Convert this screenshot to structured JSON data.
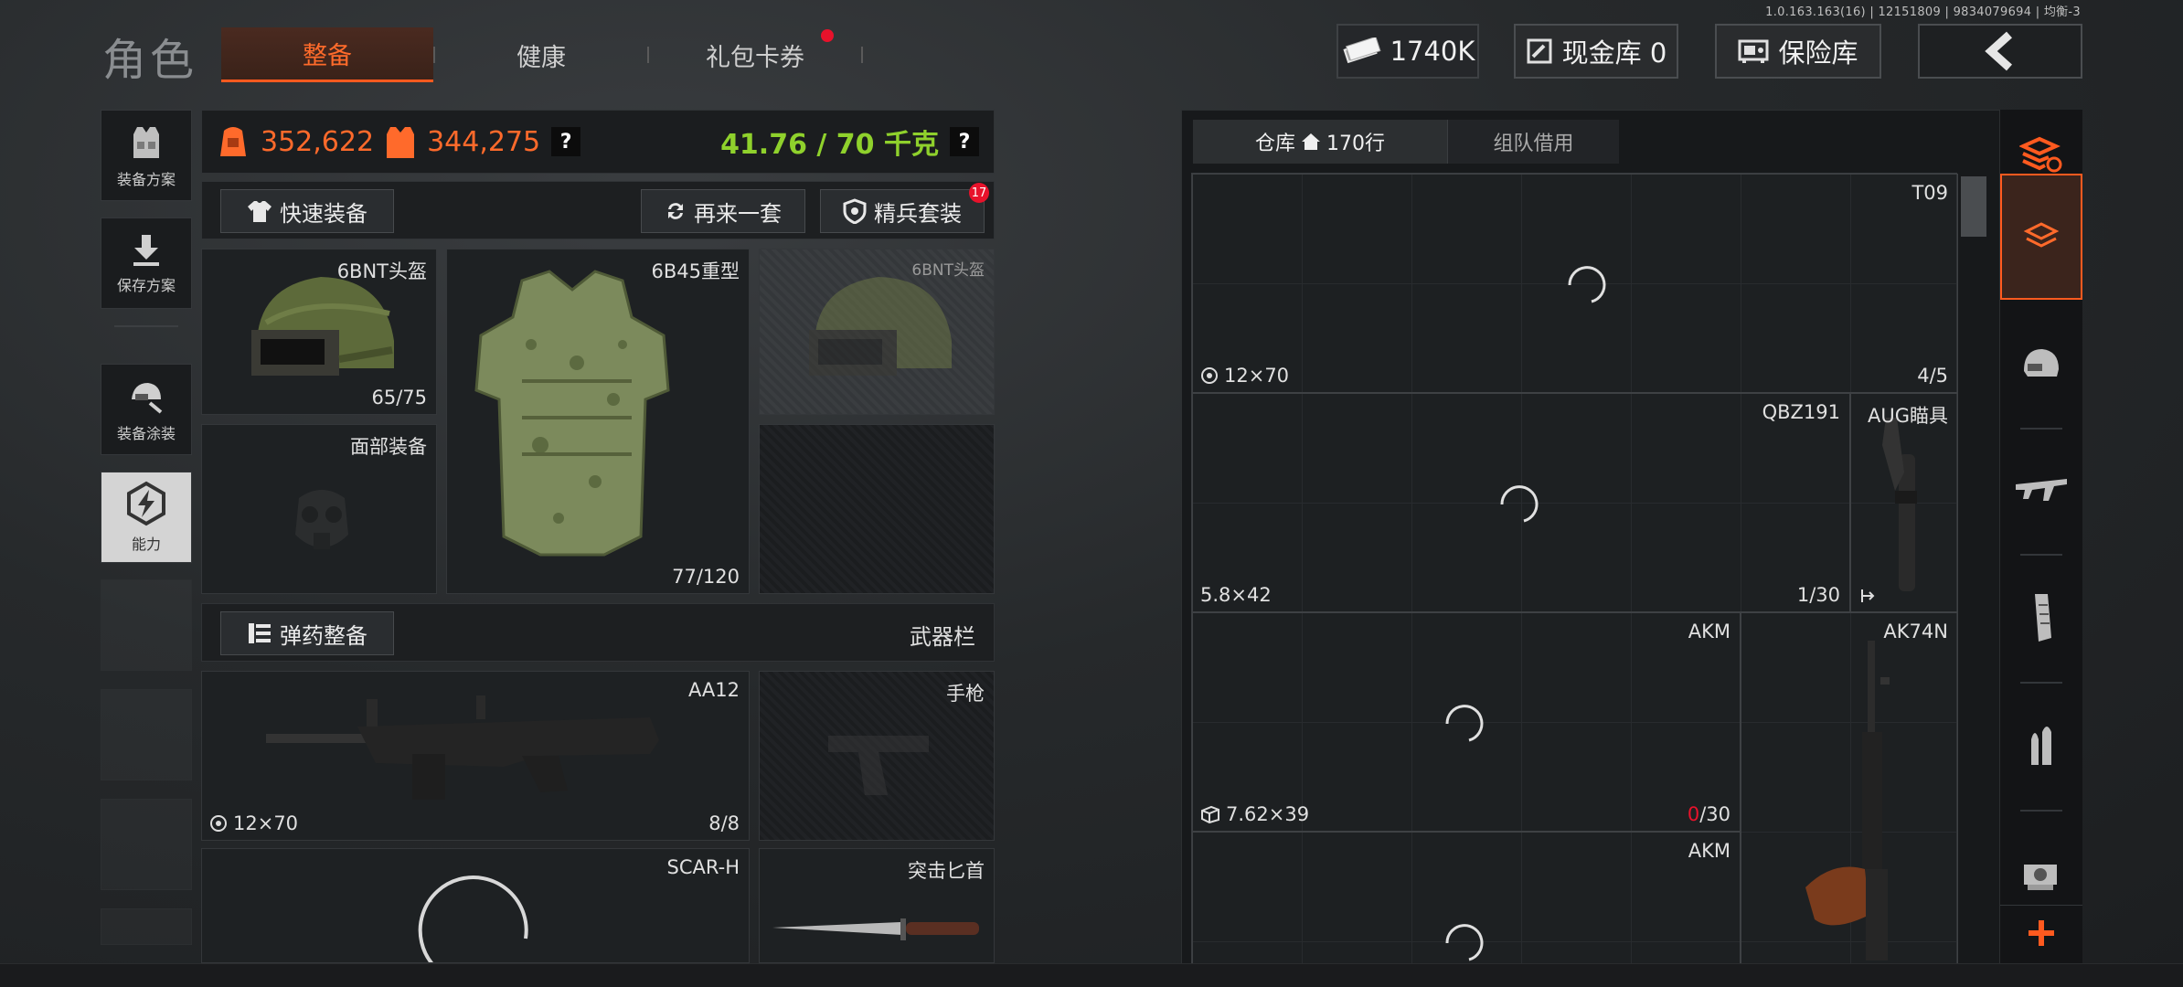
{
  "build_info": "1.0.163.163(16) | 12151809 | 9834079694 | 均衡-3",
  "header": {
    "title": "角色",
    "tabs": [
      {
        "label": "整备",
        "active": true
      },
      {
        "label": "健康",
        "active": false
      },
      {
        "label": "礼包卡券",
        "active": false,
        "has_notification": true
      }
    ],
    "money": "1740K",
    "cash_vault": "现金库 0",
    "safe": "保险库",
    "back_icon": "chevron-left-icon"
  },
  "sidebar": {
    "items": [
      {
        "label": "装备方案",
        "icon": "vest-icon"
      },
      {
        "label": "保存方案",
        "icon": "download-icon"
      },
      {
        "label": "装备涂装",
        "icon": "paint-helmet-icon"
      },
      {
        "label": "能力",
        "icon": "lightning-hex-icon",
        "selected": true
      }
    ]
  },
  "stats": {
    "value_1": "352,622",
    "value_2": "344,275",
    "help": "?",
    "weight": "41.76 / 70 千克"
  },
  "actions": {
    "quick_equip": "快速装备",
    "reroll": "再来一套",
    "elite_set": "精兵套装",
    "elite_badge": "17"
  },
  "equipment": {
    "helmet": {
      "title": "6BNT头盔",
      "count": "65/75"
    },
    "armor": {
      "title": "6B45重型",
      "count": "77/120"
    },
    "helmet_ghost": {
      "title": "6BNT头盔"
    },
    "face": {
      "title": "面部装备"
    }
  },
  "ammo_bar": {
    "ammo_equip": "弹药整备",
    "weapon_bar": "武器栏"
  },
  "weapons": {
    "primary": {
      "title": "AA12",
      "ammo": "12×70",
      "count": "8/8"
    },
    "pistol": {
      "title": "手枪"
    },
    "secondary": {
      "title": "SCAR-H"
    },
    "melee": {
      "title": "突击匕首"
    }
  },
  "warehouse": {
    "tab_storage": "仓库",
    "rows": "170行",
    "tab_team": "组队借用",
    "items": [
      {
        "title": "T09",
        "ammo": "12×70",
        "count": "4/5"
      },
      {
        "title": "QBZ191",
        "ammo": "5.8×42",
        "count": "1/30"
      },
      {
        "title": "AUG瞄具"
      },
      {
        "title": "AKM",
        "ammo": "7.62×39",
        "count_red": "0",
        "count_rest": "/30"
      },
      {
        "title": "AK74N"
      },
      {
        "title": "AKM"
      }
    ]
  },
  "rail": {
    "icons": [
      "swap-layers-icon",
      "layers-icon",
      "helmet-icon",
      "rifle-icon",
      "magazine-icon",
      "bullets-icon",
      "scope-icon",
      "plus-icon"
    ]
  },
  "colors": {
    "accent": "#ff5a1f",
    "weight_green": "#8fd12c",
    "notice_red": "#e8122b"
  }
}
